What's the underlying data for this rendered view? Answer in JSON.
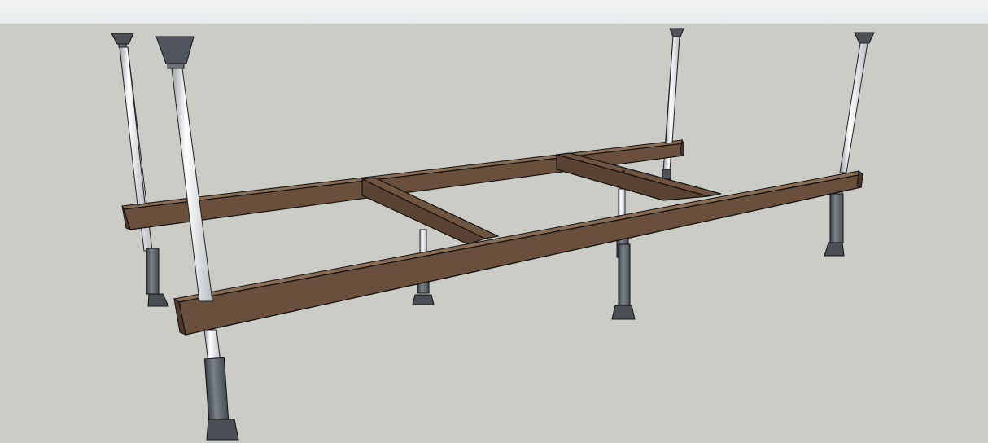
{
  "viewport": {
    "sky_color": "#eef0f1",
    "ground_color": "#ccccc6",
    "model": "bathtub-support-frame"
  },
  "colors": {
    "beam_top": "#7a5e47",
    "beam_side": "#5b4433",
    "beam_end": "#6b513d",
    "rod": "#e4e6e8",
    "foot": "#5a5f66",
    "edge": "#111111"
  }
}
